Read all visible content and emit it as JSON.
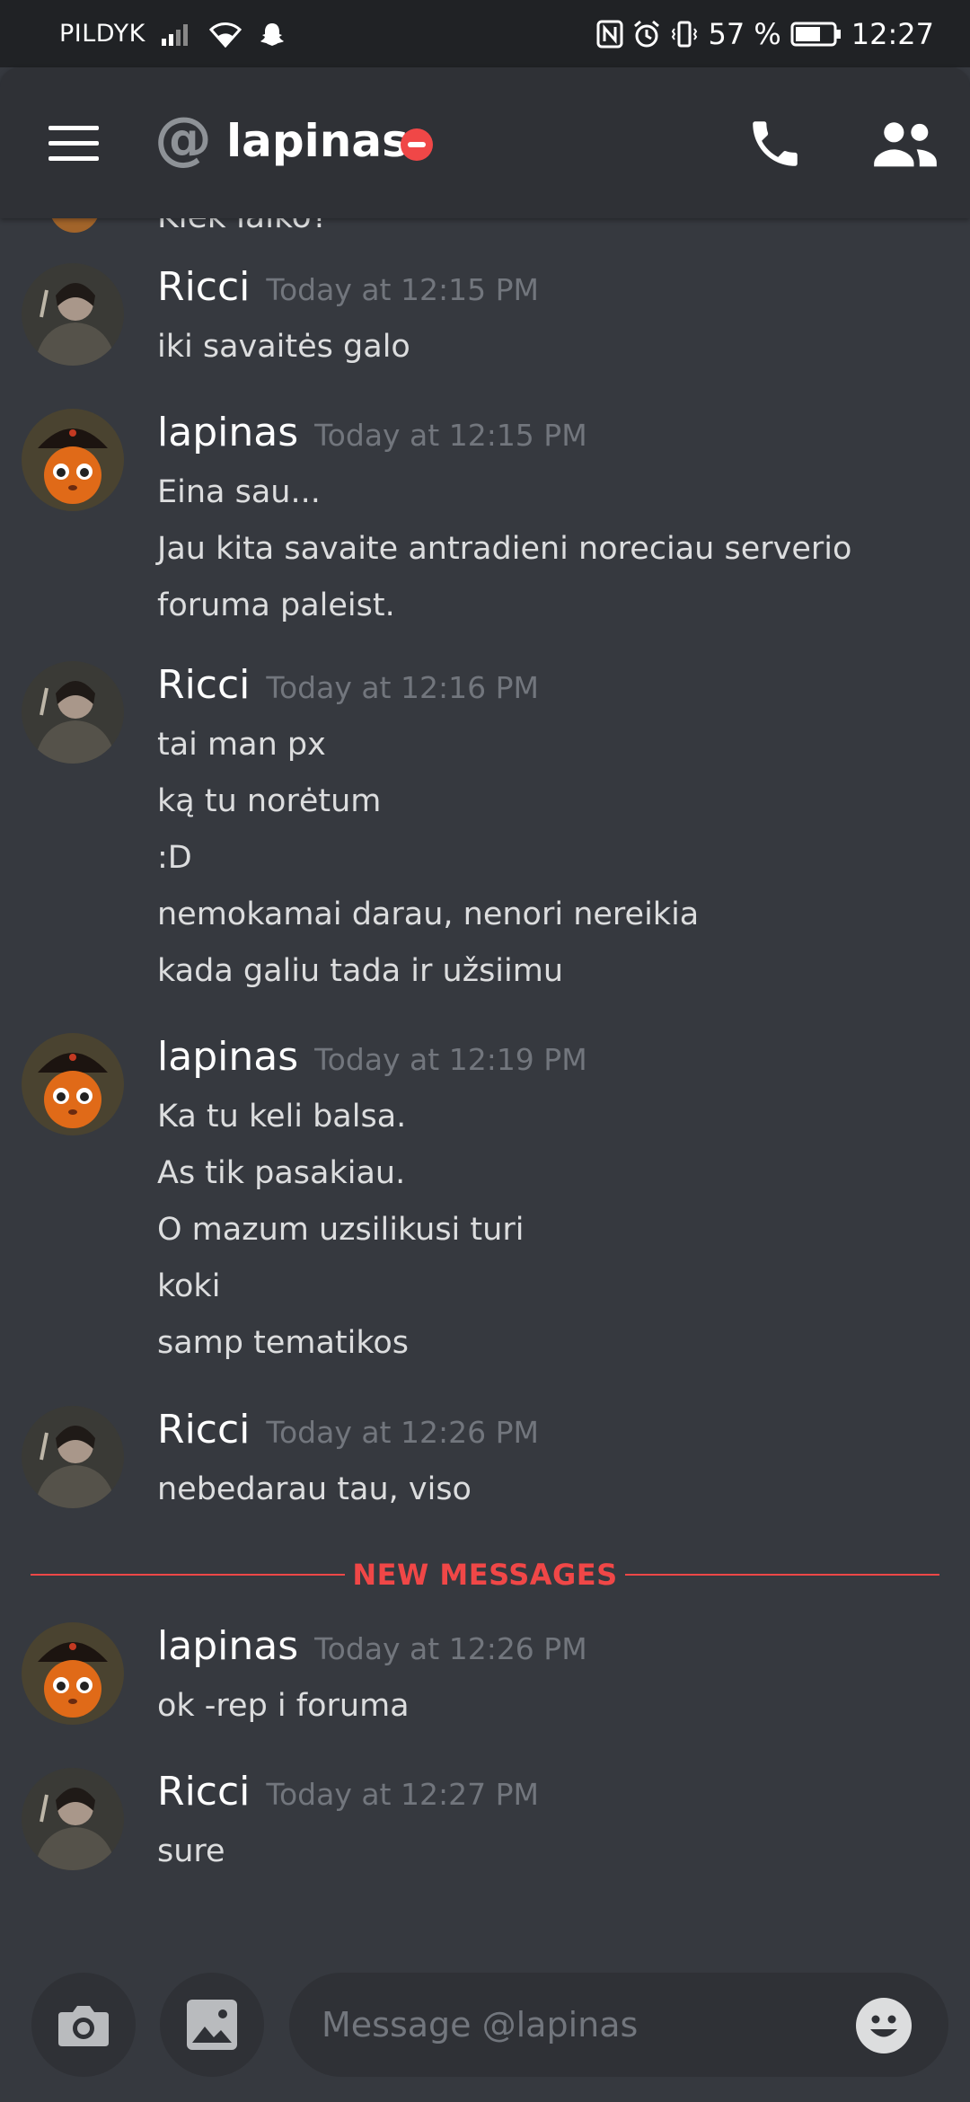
{
  "status_bar": {
    "carrier": "PILDYK",
    "battery": "57 %",
    "time": "12:27"
  },
  "header": {
    "channel_name": "lapinas"
  },
  "partial_message": "Kiek laiko?",
  "messages": [
    {
      "author": "Ricci",
      "time": "Today at 12:15 PM",
      "lines": [
        "iki savaitės galo"
      ]
    },
    {
      "author": "lapinas",
      "time": "Today at 12:15 PM",
      "lines": [
        "Eina sau...",
        "Jau kita savaite antradieni noreciau serverio",
        "foruma paleist."
      ]
    },
    {
      "author": "Ricci",
      "time": "Today at 12:16 PM",
      "lines": [
        "tai man px",
        "ką tu norėtum",
        ":D",
        "nemokamai darau, nenori nereikia",
        "kada galiu tada ir užsiimu"
      ]
    },
    {
      "author": "lapinas",
      "time": "Today at 12:19 PM",
      "lines": [
        "Ka tu keli balsa.",
        "As tik pasakiau.",
        "O mazum uzsilikusi turi",
        "koki",
        "samp tematikos"
      ]
    },
    {
      "author": "Ricci",
      "time": "Today at 12:26 PM",
      "lines": [
        "nebedarau tau, viso"
      ]
    },
    {
      "author": "lapinas",
      "time": "Today at 12:26 PM",
      "lines": [
        "ok -rep i foruma"
      ]
    },
    {
      "author": "Ricci",
      "time": "Today at 12:27 PM",
      "lines": [
        "sure"
      ]
    }
  ],
  "new_messages_label": "NEW MESSAGES",
  "composer": {
    "placeholder": "Message @lapinas"
  },
  "colors": {
    "background": "#36393f",
    "header": "#2f3136",
    "accent_red": "#f04747",
    "timestamp": "#72767d"
  }
}
